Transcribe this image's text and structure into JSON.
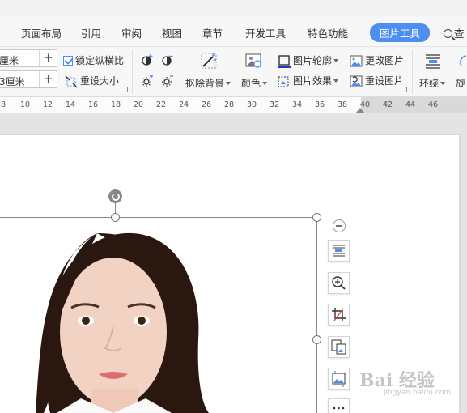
{
  "menu": {
    "items": [
      "页面布局",
      "引用",
      "审阅",
      "视图",
      "章节",
      "开发工具",
      "特色功能"
    ],
    "active_tab": "图片工具",
    "search_label": "查"
  },
  "ribbon": {
    "height_field": "厘米",
    "width_field": "3厘米",
    "lock_ratio": "锁定纵横比",
    "reset_size": "重设大小",
    "remove_bg": "抠除背景",
    "color": "颜色",
    "outline": "图片轮廓",
    "effect": "图片效果",
    "change_pic": "更改图片",
    "reset_pic": "重设图片",
    "wrap": "环绕",
    "rotate": "旋"
  },
  "ruler": {
    "ticks": [
      "8",
      "10",
      "12",
      "14",
      "16",
      "18",
      "20",
      "22",
      "24",
      "26",
      "28",
      "30",
      "32",
      "34",
      "36",
      "38",
      "40",
      "42",
      "44",
      "46"
    ]
  },
  "watermark": {
    "main": "Bai 经验",
    "sub": "jingyan.baidu.com"
  },
  "colors": {
    "accent": "#4d8ef0",
    "menu_bg": "#f7f7f7",
    "canvas_bg": "#e4e4e4"
  }
}
